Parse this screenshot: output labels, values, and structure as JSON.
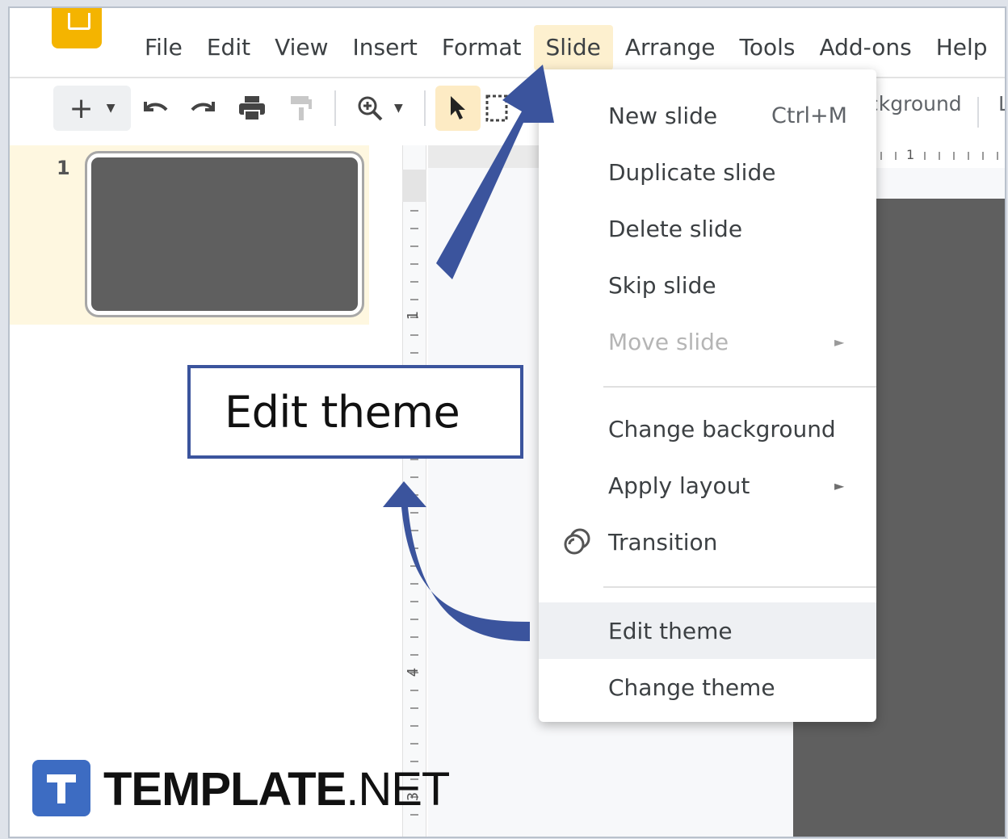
{
  "menubar": {
    "items": [
      "File",
      "Edit",
      "View",
      "Insert",
      "Format",
      "Slide",
      "Arrange",
      "Tools",
      "Add-ons",
      "Help"
    ],
    "active": "Slide"
  },
  "toolbar": {
    "icons": [
      "add-icon",
      "undo-icon",
      "redo-icon",
      "print-icon",
      "paint-format-icon",
      "zoom-icon",
      "select-icon",
      "textbox-icon"
    ],
    "truncated_button": "ckground",
    "truncated_button2": "L"
  },
  "filmstrip": {
    "slide_number": "1"
  },
  "ruler": {
    "h_label": "1",
    "v_label_1": "1",
    "v_label_2": "4",
    "v_label_3": "3"
  },
  "slide_menu": {
    "new_slide": "New slide",
    "new_slide_shortcut": "Ctrl+M",
    "duplicate_slide": "Duplicate slide",
    "delete_slide": "Delete slide",
    "skip_slide": "Skip slide",
    "move_slide": "Move slide",
    "change_background": "Change background",
    "apply_layout": "Apply layout",
    "transition": "Transition",
    "edit_theme": "Edit theme",
    "change_theme": "Change theme",
    "submenu_arrow": "►"
  },
  "callout": {
    "text": "Edit theme",
    "border_color": "#3b549d"
  },
  "watermark": {
    "brand_bold": "TEMPLATE",
    "brand_suffix": ".NET",
    "accent": "#3d6cc2"
  },
  "colors": {
    "arrow": "#3b549d",
    "highlight": "#fdf0cf",
    "slide_fill": "#5f5f5f",
    "app_logo": "#f4b400"
  }
}
